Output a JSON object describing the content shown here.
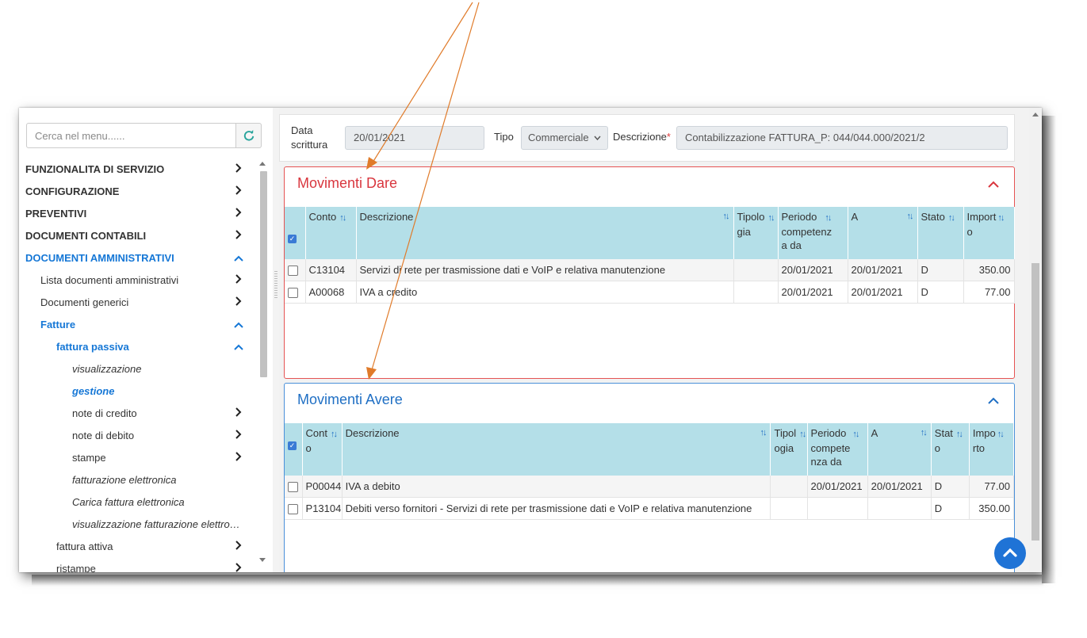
{
  "sidebar": {
    "search_placeholder": "Cerca nel menu......",
    "items": [
      {
        "label": "FUNZIONALITA DI SERVIZIO",
        "chev": "right"
      },
      {
        "label": "CONFIGURAZIONE",
        "chev": "right"
      },
      {
        "label": "PREVENTIVI",
        "chev": "right"
      },
      {
        "label": "DOCUMENTI CONTABILI",
        "chev": "right"
      },
      {
        "label": "DOCUMENTI AMMINISTRATIVI",
        "chev": "up"
      },
      {
        "label": "Lista documenti amministrativi",
        "chev": "right"
      },
      {
        "label": "Documenti generici",
        "chev": "right"
      },
      {
        "label": "Fatture",
        "chev": "up"
      },
      {
        "label": "fattura passiva",
        "chev": "up"
      },
      {
        "label": "visualizzazione",
        "chev": ""
      },
      {
        "label": "gestione",
        "chev": ""
      },
      {
        "label": "note di credito",
        "chev": "right"
      },
      {
        "label": "note di debito",
        "chev": "right"
      },
      {
        "label": "stampe",
        "chev": "right"
      },
      {
        "label": "fatturazione elettronica",
        "chev": ""
      },
      {
        "label": "Carica fattura elettronica",
        "chev": ""
      },
      {
        "label": "visualizzazione fatturazione elettro…",
        "chev": ""
      },
      {
        "label": "fattura attiva",
        "chev": "right"
      },
      {
        "label": "ristampe",
        "chev": "right"
      }
    ]
  },
  "header": {
    "data_label_1": "Data",
    "data_label_2": "scrittura",
    "data_value": "20/01/2021",
    "tipo_label": "Tipo",
    "tipo_value": "Commerciale",
    "descr_label": "Descrizione",
    "req_mark": "*",
    "descr_value": "Contabilizzazione FATTURA_P: 044/044.000/2021/2"
  },
  "dare": {
    "title": "Movimenti Dare",
    "headers": {
      "conto": "Conto",
      "descrizione": "Descrizione",
      "tipologia_1": "Tipolo",
      "tipologia_2": "gia",
      "periodo_1": "Periodo",
      "periodo_2": "competenz",
      "periodo_3": "a da",
      "a": "A",
      "stato": "Stato",
      "importo_1": "Import",
      "importo_2": "o"
    },
    "rows": [
      {
        "conto": "C13104",
        "descrizione": "Servizi di rete per trasmissione dati e VoIP e relativa manutenzione",
        "tipologia": "",
        "da": "20/01/2021",
        "a": "20/01/2021",
        "stato": "D",
        "importo": "350.00"
      },
      {
        "conto": "A00068",
        "descrizione": "IVA a credito",
        "tipologia": "",
        "da": "20/01/2021",
        "a": "20/01/2021",
        "stato": "D",
        "importo": "77.00"
      }
    ]
  },
  "avere": {
    "title": "Movimenti Avere",
    "headers": {
      "conto_1": "Cont",
      "conto_2": "o",
      "descrizione": "Descrizione",
      "tipologia_1": "Tipol",
      "tipologia_2": "ogia",
      "periodo_1": "Periodo",
      "periodo_2": "compete",
      "periodo_3": "nza da",
      "a": "A",
      "stato_1": "Stat",
      "stato_2": "o",
      "importo_1": "Impo",
      "importo_2": "rto"
    },
    "rows": [
      {
        "conto": "P00044",
        "descrizione": "IVA a debito",
        "tipologia": "",
        "da": "20/01/2021",
        "a": "20/01/2021",
        "stato": "D",
        "importo": "77.00"
      },
      {
        "conto": "P13104",
        "descrizione": "Debiti verso fornitori - Servizi di rete per trasmissione dati e VoIP e relativa manutenzione",
        "tipologia": "",
        "da": "",
        "a": "",
        "stato": "D",
        "importo": "350.00"
      }
    ]
  },
  "colors": {
    "accent": "#1577d6",
    "dare": "#d9363e",
    "avere": "#1f6fc4",
    "table_header": "#b4dfe8",
    "annotation_arrow": "#e07b2a"
  }
}
